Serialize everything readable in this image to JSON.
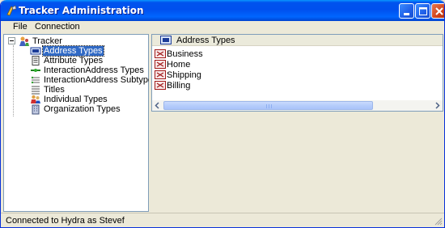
{
  "window": {
    "title": "Tracker Administration",
    "accent_color": "#0054e3",
    "controls": [
      "minimize-icon",
      "maximize-icon",
      "close-icon"
    ]
  },
  "menu": {
    "items": [
      {
        "label": "File"
      },
      {
        "label": "Connection"
      }
    ]
  },
  "tree": {
    "root": {
      "label": "Tracker",
      "icon": "tracker-icon",
      "expanded": true
    },
    "items": [
      {
        "label": "Address Types",
        "icon": "address-card-icon",
        "selected": true
      },
      {
        "label": "Attribute Types",
        "icon": "attribute-list-icon",
        "selected": false
      },
      {
        "label": "InteractionAddress Types",
        "icon": "interaction-icon",
        "selected": false
      },
      {
        "label": "InteractionAddress Subtypes",
        "icon": "interaction-subtype-icon",
        "selected": false
      },
      {
        "label": "Titles",
        "icon": "titles-icon",
        "selected": false
      },
      {
        "label": "Individual Types",
        "icon": "people-icon",
        "selected": false
      },
      {
        "label": "Organization Types",
        "icon": "building-icon",
        "selected": false
      }
    ]
  },
  "list": {
    "header": {
      "label": "Address Types",
      "icon": "address-card-icon"
    },
    "rows": [
      {
        "label": "Business",
        "icon": "address-card-icon"
      },
      {
        "label": "Home",
        "icon": "address-card-icon"
      },
      {
        "label": "Shipping",
        "icon": "address-card-icon"
      },
      {
        "label": "Billing",
        "icon": "address-card-icon"
      }
    ]
  },
  "status": {
    "text": "Connected to Hydra as Stevef"
  }
}
